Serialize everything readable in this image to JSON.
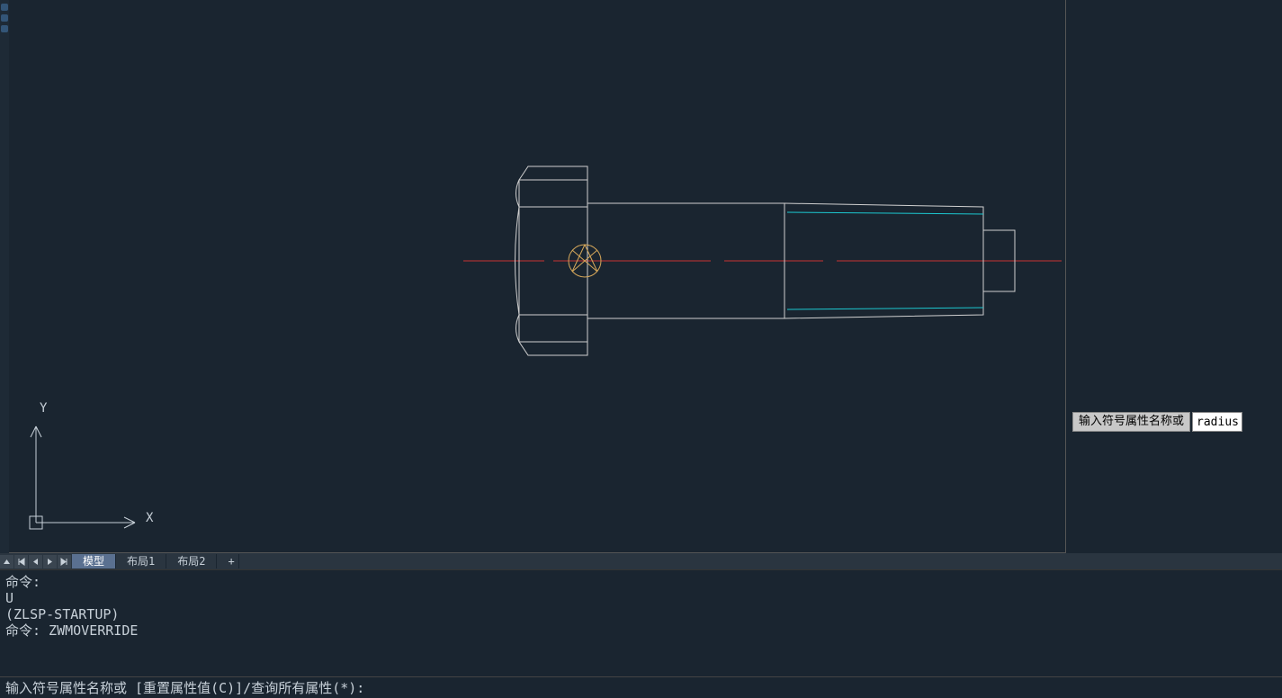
{
  "tabs": {
    "model": "模型",
    "layout1": "布局1",
    "layout2": "布局2",
    "add": "+"
  },
  "ucs": {
    "x": "X",
    "y": "Y"
  },
  "tooltip": {
    "label": "输入符号属性名称或",
    "value": "radius"
  },
  "history": {
    "l1": "命令:",
    "l2": "U",
    "l3": "(ZLSP-STARTUP)",
    "l4": "命令: ZWMOVERRIDE"
  },
  "prompt": "输入符号属性名称或 [重置属性值(C)]/查询所有属性(*):",
  "colors": {
    "bg": "#1a2530",
    "line": "#d0d0d0",
    "center": "#c83232",
    "thread": "#1cc8d0",
    "cursor": "#d7a85a"
  }
}
